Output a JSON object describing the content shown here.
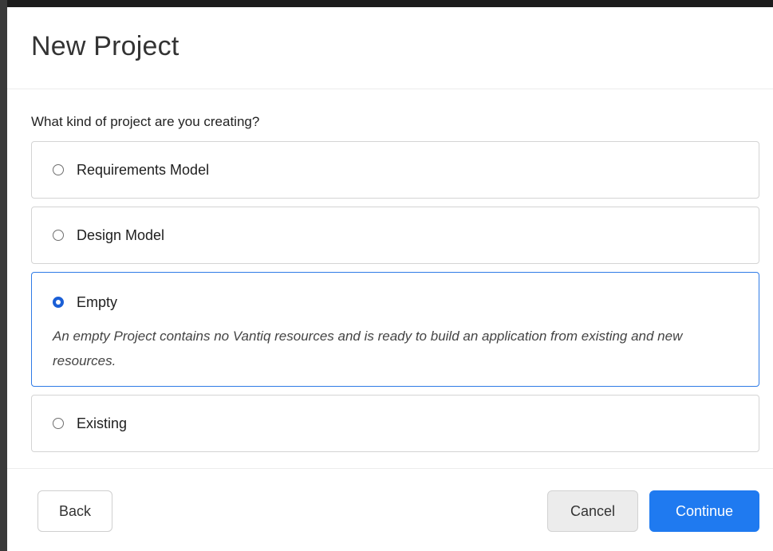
{
  "dialog": {
    "title": "New Project",
    "question": "What kind of project are you creating?"
  },
  "options": [
    {
      "label": "Requirements Model",
      "selected": false,
      "description": ""
    },
    {
      "label": "Design Model",
      "selected": false,
      "description": ""
    },
    {
      "label": "Empty",
      "selected": true,
      "description": "An empty Project contains no Vantiq resources and is ready to build an application from existing and new resources."
    },
    {
      "label": "Existing",
      "selected": false,
      "description": ""
    }
  ],
  "footer": {
    "back_label": "Back",
    "cancel_label": "Cancel",
    "continue_label": "Continue"
  },
  "colors": {
    "accent": "#1f7af0",
    "selected_border": "#2f7be6",
    "radio_checked": "#1b5fd6"
  }
}
